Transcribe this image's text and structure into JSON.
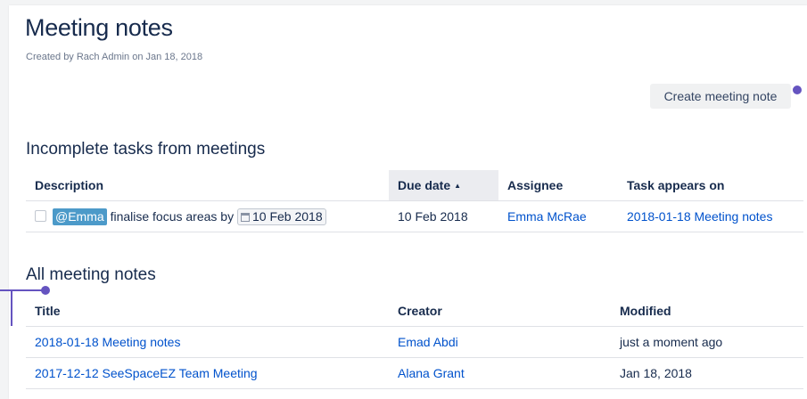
{
  "header": {
    "title": "Meeting notes",
    "byline": "Created by Rach Admin on Jan 18, 2018",
    "create_button": "Create meeting note"
  },
  "tasks": {
    "heading": "Incomplete tasks from meetings",
    "columns": {
      "description": "Description",
      "due": "Due date",
      "assignee": "Assignee",
      "appears_on": "Task appears on"
    },
    "rows": [
      {
        "mention": "@Emma",
        "text": "finalise focus areas by",
        "inline_date": "10 Feb 2018",
        "due": "10 Feb 2018",
        "assignee": "Emma McRae",
        "appears_on": "2018-01-18 Meeting notes"
      }
    ]
  },
  "notes": {
    "heading": "All meeting notes",
    "columns": {
      "title": "Title",
      "creator": "Creator",
      "modified": "Modified"
    },
    "rows": [
      {
        "title": "2018-01-18 Meeting notes",
        "creator": "Emad Abdi",
        "modified": "just a moment ago"
      },
      {
        "title": "2017-12-12 SeeSpaceEZ Team Meeting",
        "creator": "Alana Grant",
        "modified": "Jan 18, 2018"
      }
    ]
  },
  "colors": {
    "accent": "#6554c0",
    "link": "#0052cc",
    "mention": "#4c9ac9"
  },
  "icons": {
    "calendar": "calendar-icon",
    "sort": "sort-ascending-icon"
  }
}
